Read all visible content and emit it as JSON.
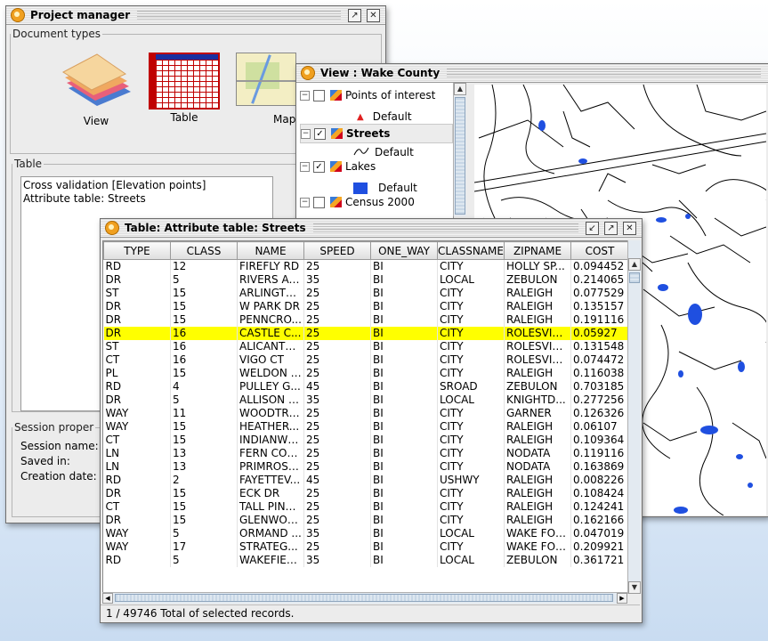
{
  "project_manager": {
    "title": "Project manager",
    "document_types_label": "Document types",
    "doc_types": [
      {
        "label": "View",
        "icon": "view-layers-icon"
      },
      {
        "label": "Table",
        "icon": "table-grid-icon"
      },
      {
        "label": "Map",
        "icon": "map-thumbnail-icon"
      }
    ],
    "table_label": "Table",
    "table_items": [
      "Cross validation [Elevation points]",
      "Attribute table: Streets"
    ],
    "session_label": "Session proper",
    "session_fields": {
      "name": "Session name:",
      "saved": "Saved in:",
      "created": "Creation date:"
    }
  },
  "view": {
    "title": "View : Wake County",
    "layers": [
      {
        "name": "Points of interest",
        "checked": false,
        "legend": "Default",
        "symbol": "triangle-icon"
      },
      {
        "name": "Streets",
        "checked": true,
        "legend": "Default",
        "symbol": "line-icon"
      },
      {
        "name": "Lakes",
        "checked": true,
        "legend": "Default",
        "symbol": "square-icon"
      },
      {
        "name": "Census 2000",
        "checked": false
      }
    ]
  },
  "table": {
    "title": "Table: Attribute table: Streets",
    "columns": [
      "TYPE",
      "CLASS",
      "NAME",
      "SPEED",
      "ONE_WAY",
      "CLASSNAME",
      "ZIPNAME",
      "COST"
    ],
    "rows": [
      [
        "RD",
        "12",
        "FIREFLY RD",
        "25",
        "BI",
        "CITY",
        "HOLLY SP...",
        "0.094452"
      ],
      [
        "DR",
        "5",
        "RIVERS AC...",
        "35",
        "BI",
        "LOCAL",
        "ZEBULON",
        "0.214065"
      ],
      [
        "ST",
        "15",
        "ARLINGTO...",
        "25",
        "BI",
        "CITY",
        "RALEIGH",
        "0.077529"
      ],
      [
        "DR",
        "15",
        "W PARK DR",
        "25",
        "BI",
        "CITY",
        "RALEIGH",
        "0.135157"
      ],
      [
        "DR",
        "15",
        "PENNCRO...",
        "25",
        "BI",
        "CITY",
        "RALEIGH",
        "0.191116"
      ],
      [
        "DR",
        "16",
        "CASTLE C...",
        "25",
        "BI",
        "CITY",
        "ROLESVILLE",
        "0.05927"
      ],
      [
        "ST",
        "16",
        "ALICANTE...",
        "25",
        "BI",
        "CITY",
        "ROLESVILLE",
        "0.131548"
      ],
      [
        "CT",
        "16",
        "VIGO CT",
        "25",
        "BI",
        "CITY",
        "ROLESVILLE",
        "0.074472"
      ],
      [
        "PL",
        "15",
        "WELDON PL",
        "25",
        "BI",
        "CITY",
        "RALEIGH",
        "0.116038"
      ],
      [
        "RD",
        "4",
        "PULLEY G...",
        "45",
        "BI",
        "SROAD",
        "ZEBULON",
        "0.703185"
      ],
      [
        "DR",
        "5",
        "ALLISON DR",
        "35",
        "BI",
        "LOCAL",
        "KNIGHTD...",
        "0.277256"
      ],
      [
        "WAY",
        "11",
        "WOODTRE...",
        "25",
        "BI",
        "CITY",
        "GARNER",
        "0.126326"
      ],
      [
        "WAY",
        "15",
        "HEATHER...",
        "25",
        "BI",
        "CITY",
        "RALEIGH",
        "0.06107"
      ],
      [
        "CT",
        "15",
        "INDIANWO...",
        "25",
        "BI",
        "CITY",
        "RALEIGH",
        "0.109364"
      ],
      [
        "LN",
        "13",
        "FERN COT...",
        "25",
        "BI",
        "CITY",
        "NODATA",
        "0.119116"
      ],
      [
        "LN",
        "13",
        "PRIMROSE...",
        "25",
        "BI",
        "CITY",
        "NODATA",
        "0.163869"
      ],
      [
        "RD",
        "2",
        "FAYETTEV...",
        "45",
        "BI",
        "USHWY",
        "RALEIGH",
        "0.008226"
      ],
      [
        "DR",
        "15",
        "ECK DR",
        "25",
        "BI",
        "CITY",
        "RALEIGH",
        "0.108424"
      ],
      [
        "CT",
        "15",
        "TALL PINE...",
        "25",
        "BI",
        "CITY",
        "RALEIGH",
        "0.124241"
      ],
      [
        "DR",
        "15",
        "GLENWOO...",
        "25",
        "BI",
        "CITY",
        "RALEIGH",
        "0.162166"
      ],
      [
        "WAY",
        "5",
        "ORMAND ...",
        "35",
        "BI",
        "LOCAL",
        "WAKE FOR...",
        "0.047019"
      ],
      [
        "WAY",
        "17",
        "STRATEG...",
        "25",
        "BI",
        "CITY",
        "WAKE FOR...",
        "0.209921"
      ],
      [
        "RD",
        "5",
        "WAKEFIEL...",
        "35",
        "BI",
        "LOCAL",
        "ZEBULON",
        "0.361721"
      ]
    ],
    "selected_row_index": 5,
    "status": "1 / 49746 Total of selected records."
  },
  "colors": {
    "selection": "#ffff00",
    "lake_fill": "#1f4fe0",
    "desktop_blue": "#c9dcf1"
  }
}
